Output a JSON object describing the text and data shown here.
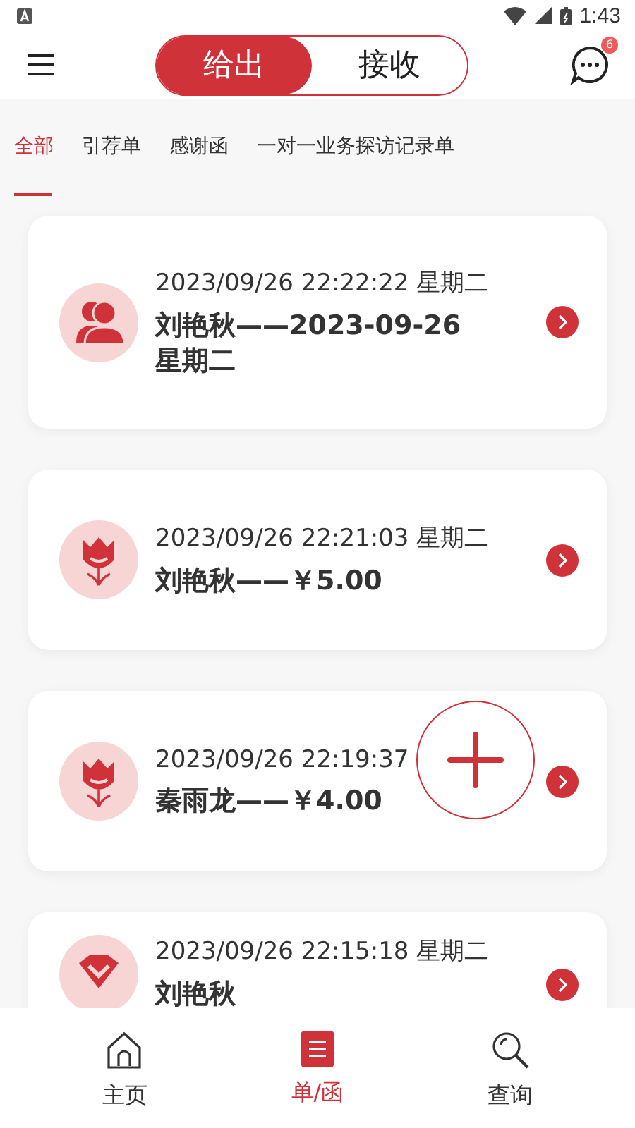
{
  "status_bar": {
    "time": "1:43"
  },
  "header": {
    "segments": [
      {
        "label": "给出",
        "selected": true
      },
      {
        "label": "接收",
        "selected": false
      }
    ],
    "message_badge": "6"
  },
  "categories": [
    {
      "label": "全部",
      "selected": true
    },
    {
      "label": "引荐单",
      "selected": false
    },
    {
      "label": "感谢函",
      "selected": false
    },
    {
      "label": "一对一业务探访记录单",
      "selected": false
    }
  ],
  "records": [
    {
      "kind": "people",
      "date": "2023/09/26 22:22:22 星期二",
      "name": "刘艳秋——2023-09-26 星期二"
    },
    {
      "kind": "tulip",
      "date": "2023/09/26 22:21:03 星期二",
      "name": "刘艳秋——￥5.00"
    },
    {
      "kind": "tulip",
      "date": "2023/09/26 22:19:37",
      "name": "秦雨龙——￥4.00"
    },
    {
      "kind": "diamond",
      "date": "2023/09/26 22:15:18 星期二",
      "name": "刘艳秋"
    }
  ],
  "nav": [
    {
      "kind": "home",
      "label": "主页",
      "selected": false
    },
    {
      "kind": "list",
      "label": "单/函",
      "selected": true
    },
    {
      "kind": "search",
      "label": "查询",
      "selected": false
    }
  ]
}
